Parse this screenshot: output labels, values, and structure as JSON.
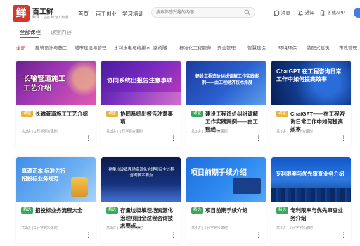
{
  "header": {
    "logo_char": "鲜",
    "logo_name": "百工鲜",
    "logo_slogan": "聚百工之技 鲜为人知道",
    "nav": [
      "首页",
      "百工创业",
      "学习培训"
    ],
    "search_placeholder": "搜索你感兴趣的内容",
    "links": [
      "消息",
      "通知",
      "下载APP"
    ]
  },
  "tabs": [
    "全部课程",
    "课堂内容"
  ],
  "filters": [
    "全部",
    "建筑设计与施工",
    "城市建设与管理",
    "水利水电与给排水",
    "路桥隧",
    "标准化工程服务",
    "安全管理",
    "智慧建造",
    "环境环保",
    "装配式建筑",
    "市政管理"
  ],
  "cards": [
    {
      "thumb_text": "长输管道施工工艺介绍",
      "badge": "课堂",
      "title": "长输管道施工工艺介绍",
      "meta": "共3讲 | 1节学时6课时"
    },
    {
      "thumb_text": "协同系统出报告注意事项",
      "badge": "课堂",
      "title": "协同系统出报告注意事项",
      "meta": "共3讲 | 1节学时6课时"
    },
    {
      "thumb_text": "建设工程造价纠纷调解工作实践案例——由工程经济技术角度",
      "badge": "课堂",
      "title": "建设工程造价纠纷调解工作实践案例——由工程经...",
      "meta": "共3讲 | 1节学时6课时"
    },
    {
      "thumb_text": "ChatGPT 在工程咨询日常工作中如何提高效率",
      "badge": "课堂",
      "title": "ChatGPT——在工程咨询日常工作中如何提高效率",
      "meta": "共3讲 | 1节学时6课时"
    },
    {
      "thumb_text": "真源正本 标准先行 招投标业务规范",
      "badge": "精选",
      "title": "招投标业务流程大全",
      "meta": "共3讲 | 1节学时6课时"
    },
    {
      "thumb_text": "存量垃圾填埋场资源化治理项目全过程咨询技术要点",
      "badge": "精选",
      "title": "存量垃圾填埋场资源化治理项目全过程咨询技术要点...",
      "meta": "共3讲 | 1节学时6课时"
    },
    {
      "thumb_text": "项目前期手续介绍",
      "badge": "精选",
      "title": "项目前期手续介绍",
      "meta": "共4讲 | 1节学时6课时"
    },
    {
      "thumb_text": "专利限率与优先审查业务介绍",
      "badge": "精选",
      "title": "专利限率与优先审查业务介绍",
      "meta": "共3讲 | 1节学时6课时"
    }
  ],
  "colors": {
    "accent": "#d8362a",
    "badge_course": "#e8b53a",
    "badge_featured": "#3aa85c"
  }
}
